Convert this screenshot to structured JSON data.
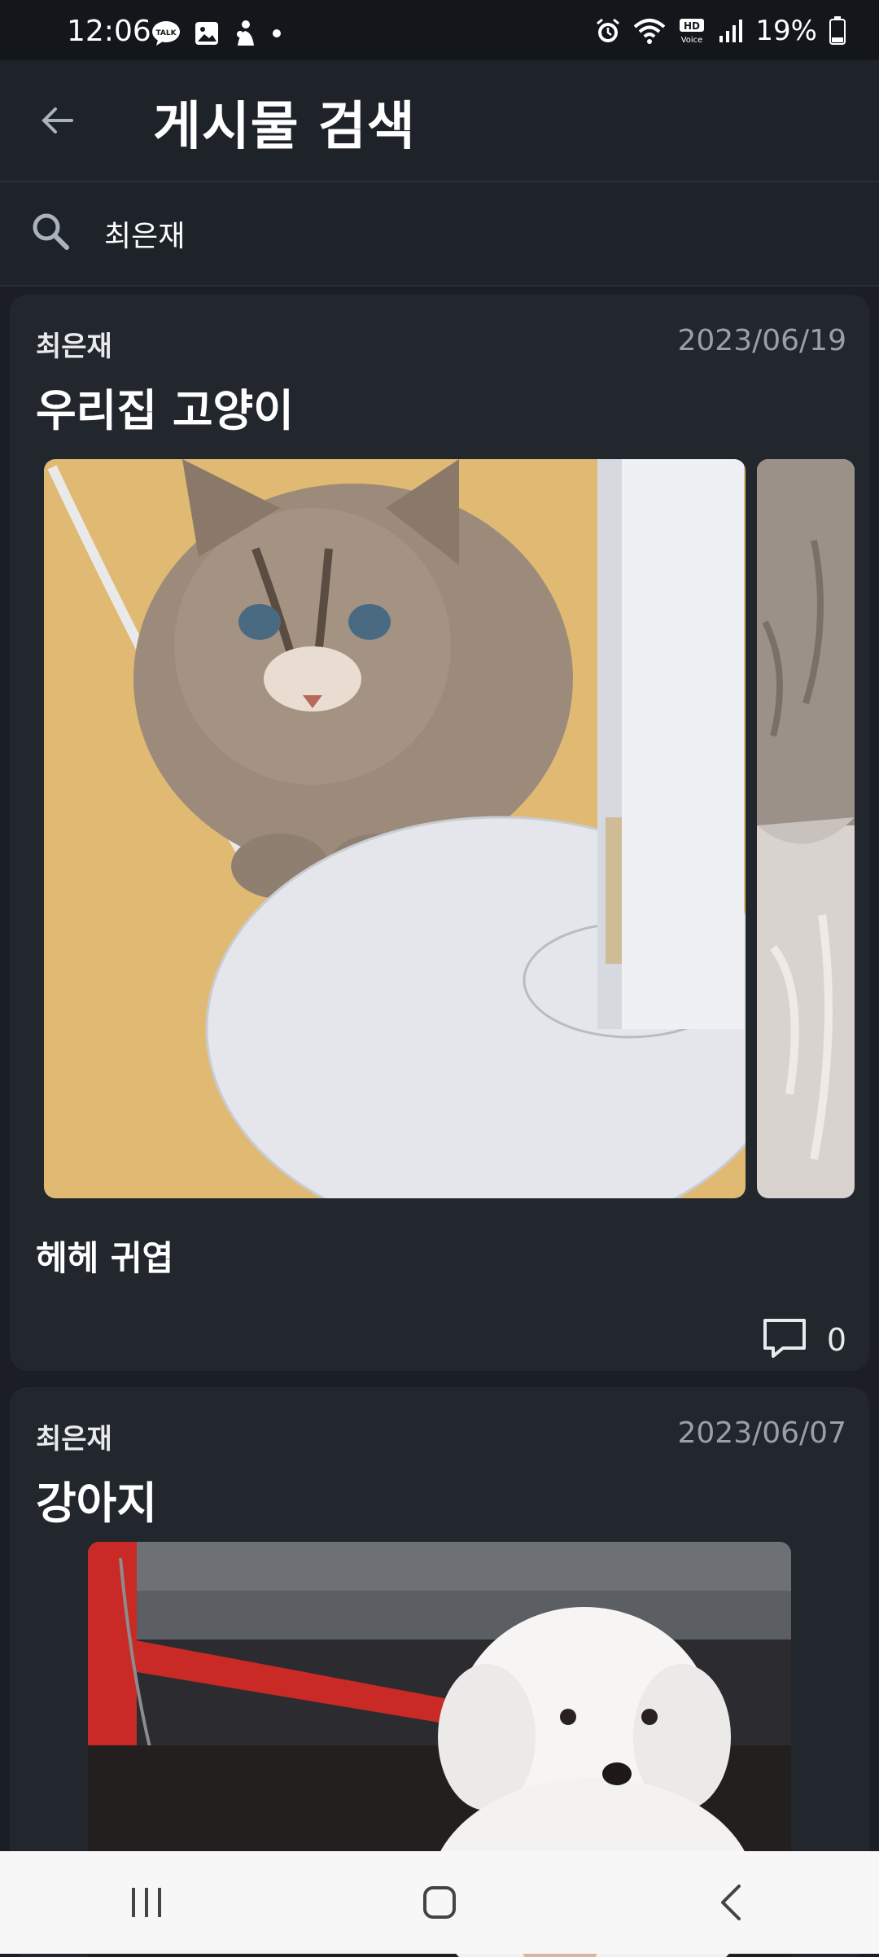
{
  "status_bar": {
    "time": "12:06",
    "battery": "19%",
    "left_icons": [
      "talk-icon",
      "gallery-icon",
      "figure-icon",
      "dot-icon"
    ],
    "right_icons": [
      "alarm-icon",
      "wifi-icon",
      "hd-voice-icon",
      "signal-icon",
      "battery-icon"
    ]
  },
  "app_bar": {
    "title": "게시물 검색",
    "back_icon": "arrow-left-icon"
  },
  "search": {
    "value": "최은재",
    "icon": "search-icon"
  },
  "posts": [
    {
      "author": "최은재",
      "date": "2023/06/19",
      "title": "우리집 고양이",
      "body": "헤헤 귀엽",
      "images": [
        "cat-photo",
        "fur-photo"
      ],
      "comment_count": "0"
    },
    {
      "author": "최은재",
      "date": "2023/06/07",
      "title": "강아지",
      "images": [
        "dog-photo"
      ]
    }
  ],
  "nav_bar": {
    "buttons": [
      "recents-icon",
      "home-icon",
      "back-icon"
    ]
  },
  "colors": {
    "background": "#1b1f25",
    "card": "#22272e",
    "date_text": "#9aa0a8",
    "navbar": "#f7f7f8"
  }
}
